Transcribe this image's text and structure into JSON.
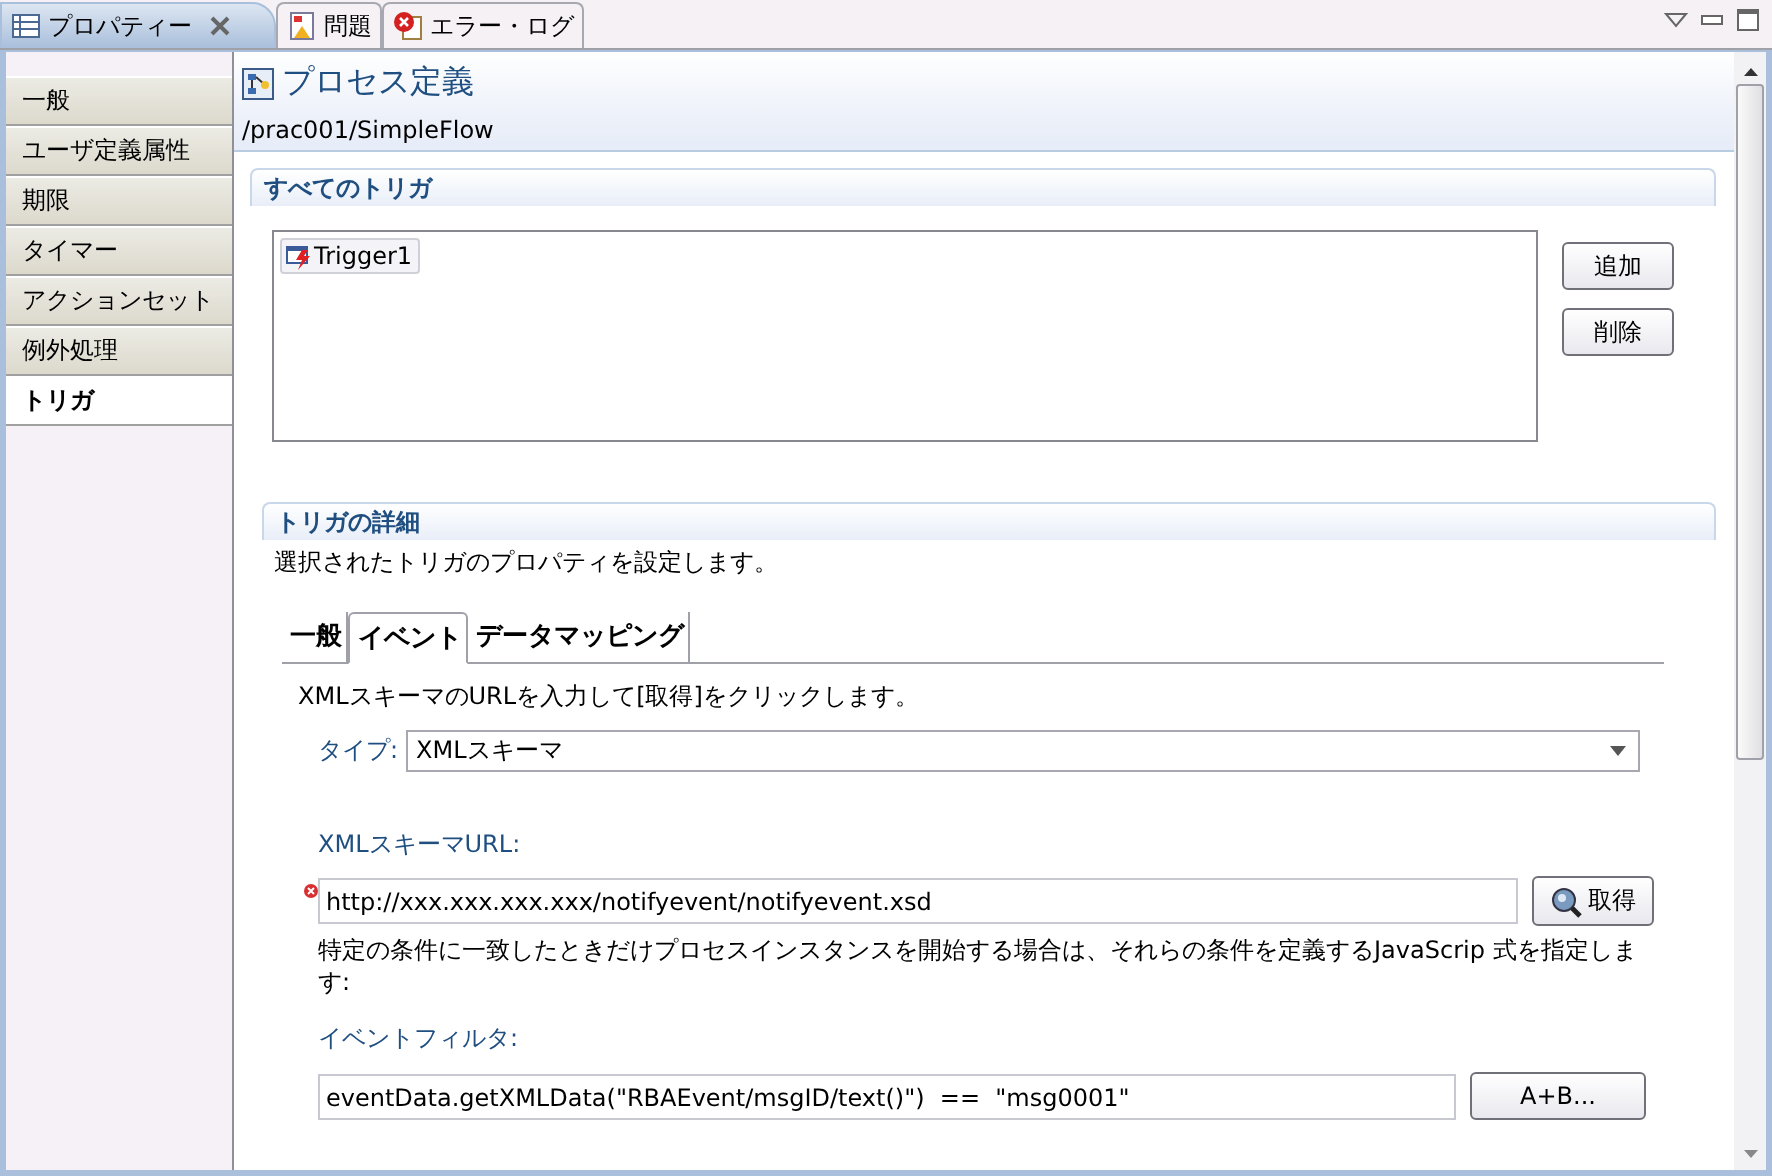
{
  "view_tabs": [
    {
      "label": "プロパティー",
      "selected": true,
      "closable": true
    },
    {
      "label": "問題",
      "selected": false,
      "closable": false
    },
    {
      "label": "エラー・ログ",
      "selected": false,
      "closable": false
    }
  ],
  "sidebar": {
    "items": [
      {
        "label": "一般",
        "selected": false
      },
      {
        "label": "ユーザ定義属性",
        "selected": false
      },
      {
        "label": "期限",
        "selected": false
      },
      {
        "label": "タイマー",
        "selected": false
      },
      {
        "label": "アクションセット",
        "selected": false
      },
      {
        "label": "例外処理",
        "selected": false
      },
      {
        "label": "トリガ",
        "selected": true
      }
    ]
  },
  "header": {
    "title": "プロセス定義",
    "path": "/prac001/SimpleFlow"
  },
  "triggers_section": {
    "title": "すべてのトリガ",
    "items": [
      {
        "label": "Trigger1",
        "selected": true
      }
    ],
    "buttons": [
      "追加",
      "削除"
    ]
  },
  "details_section": {
    "title": "トリガの詳細",
    "description": "選択されたトリガのプロパティを設定します。",
    "tabs": [
      {
        "label": "一般",
        "selected": false
      },
      {
        "label": "イベント",
        "selected": true
      },
      {
        "label": "データマッピング",
        "selected": false
      }
    ],
    "instruction": "XMLスキーマのURLを入力して[取得]をクリックします。",
    "type_label": "タイプ:",
    "type_value": "XMLスキーマ",
    "url_label": "XMLスキーマURL:",
    "url_value": "http://xxx.xxx.xxx.xxx/notifyevent/notifyevent.xsd",
    "url_error": true,
    "fetch_button": "取得",
    "filter_note": "特定の条件に一致したときだけプロセスインスタンスを開始する場合は、それらの条件を定義するJavaScrip 式を指定します:",
    "filter_label": "イベントフィルタ:",
    "filter_value": "eventData.getXMLData(\"RBAEvent/msgID/text()\")  ==  \"msg0001\"",
    "expression_button": "A+B..."
  }
}
